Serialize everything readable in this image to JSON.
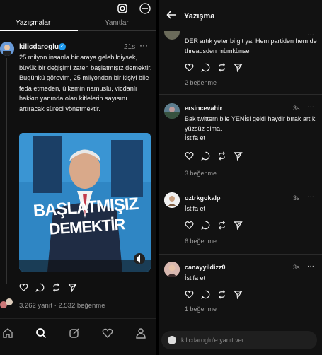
{
  "left": {
    "tabs": [
      {
        "label": "Yazışmalar"
      },
      {
        "label": "Yanıtlar"
      }
    ],
    "post": {
      "author": "kilicdaroglu",
      "verified_mark": "✓",
      "time": "21s",
      "more": "···",
      "text": "25 milyon insanla bir araya gelebildiysek, büyük bir değişimi zaten başlatmışız demektir. Bugünkü görevim, 25 milyondan bir kişiyi bile feda etmeden, ülkemin namuslu, vicdanlı hakkın yanında olan kitlelerin sayısını artıracak süreci yönetmektir.",
      "image_caption_line1": "BAŞLATMIŞIZ",
      "image_caption_line2": "DEMEKTİR",
      "stats": "3.262 yanıt · 2.532 beğenme"
    }
  },
  "right": {
    "title": "Yazışma",
    "replies": [
      {
        "user": "",
        "time": "",
        "text": "DER artık yeter bi git ya. Hem partiden hem de threadsden mümkünse",
        "likes": "2 beğenme"
      },
      {
        "user": "ersincevahir",
        "time": "3s",
        "text": "Bak twittern bile YENİsi geldi haydir bırak artık yüzsüz olma.\n İstifa et",
        "likes": "3 beğenme"
      },
      {
        "user": "oztrkgokalp",
        "time": "3s",
        "text": "İstifa et",
        "likes": "6 beğenme"
      },
      {
        "user": "canayyildizz0",
        "time": "3s",
        "text": "İstifa et",
        "likes": "1 beğenme"
      }
    ],
    "reply_placeholder": "kilicdaroglu'e yanıt ver"
  }
}
